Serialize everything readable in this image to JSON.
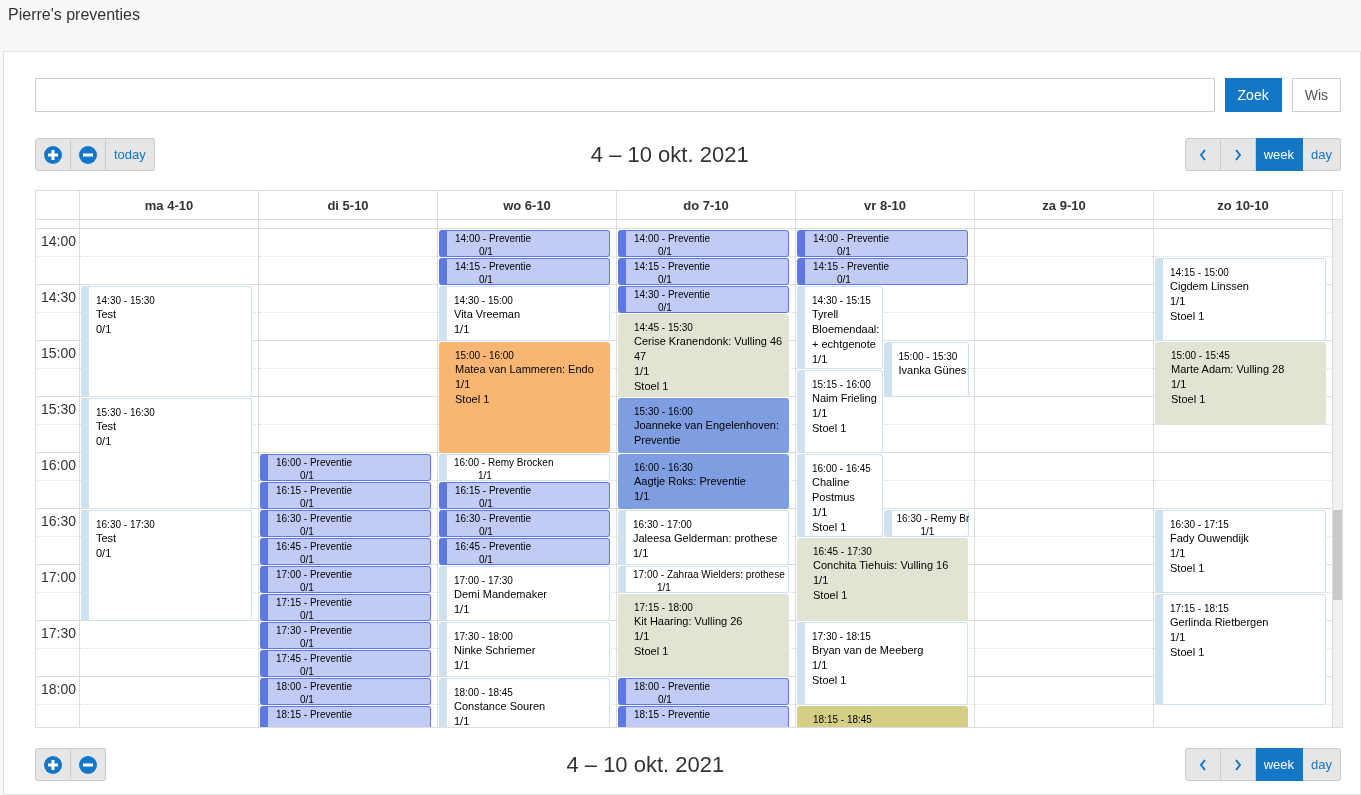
{
  "app": {
    "title": "Pierre's preventies"
  },
  "search": {
    "buttons": [
      {
        "label": "Zoek",
        "kind": "primary"
      },
      {
        "label": "Wis",
        "kind": "secondary"
      }
    ]
  },
  "top_toolbar": {
    "today": "today",
    "title": "4 – 10 okt. 2021",
    "views": [
      {
        "label": "week",
        "selected": true
      },
      {
        "label": "day",
        "selected": false
      }
    ]
  },
  "calendar": {
    "times": [
      "14:00",
      "14:30",
      "15:00",
      "15:30",
      "16:00",
      "16:30",
      "17:00",
      "17:30",
      "18:00"
    ],
    "days": [
      {
        "label": "ma 4-10",
        "events": [
          {
            "kind": "booking",
            "time": "14:30 - 15:30",
            "lines": [
              "Test",
              "0/1"
            ]
          },
          {
            "kind": "booking",
            "time": "15:30 - 16:30",
            "lines": [
              "Test",
              "0/1"
            ]
          },
          {
            "kind": "booking",
            "time": "16:30 - 17:30",
            "lines": [
              "Test",
              "0/1"
            ]
          }
        ]
      },
      {
        "label": "di 5-10",
        "events": [
          {
            "kind": "slot",
            "heading": "16:00 - Preventie",
            "count": "0/1"
          },
          {
            "kind": "slot",
            "heading": "16:15 - Preventie",
            "count": "0/1"
          },
          {
            "kind": "slot",
            "heading": "16:30 - Preventie",
            "count": "0/1"
          },
          {
            "kind": "slot",
            "heading": "16:45 - Preventie",
            "count": "0/1"
          },
          {
            "kind": "slot",
            "heading": "17:00 - Preventie",
            "count": "0/1"
          },
          {
            "kind": "slot",
            "heading": "17:15 - Preventie",
            "count": "0/1"
          },
          {
            "kind": "slot",
            "heading": "17:30 - Preventie",
            "count": "0/1"
          },
          {
            "kind": "slot",
            "heading": "17:45 - Preventie",
            "count": "0/1"
          },
          {
            "kind": "slot",
            "heading": "18:00 - Preventie",
            "count": "0/1"
          },
          {
            "kind": "slot",
            "heading": "18:15 - Preventie"
          }
        ]
      },
      {
        "label": "wo 6-10",
        "events": [
          {
            "kind": "slot",
            "heading": "14:00 - Preventie",
            "count": "0/1"
          },
          {
            "kind": "slot",
            "heading": "14:15 - Preventie",
            "count": "0/1"
          },
          {
            "kind": "booking",
            "time": "14:30 - 15:00",
            "lines": [
              "Vita Vreeman",
              "1/1"
            ]
          },
          {
            "kind": "treatment",
            "color": "#f9b672",
            "time": "15:00 - 16:00",
            "lines": [
              "Matea van Lammeren: Endo",
              "1/1",
              "Stoel 1"
            ]
          },
          {
            "kind": "short",
            "heading": "16:00 - Remy Brocken",
            "count": "1/1"
          },
          {
            "kind": "slot",
            "heading": "16:15 - Preventie",
            "count": "0/1"
          },
          {
            "kind": "slot",
            "heading": "16:30 - Preventie",
            "count": "0/1"
          },
          {
            "kind": "slot",
            "heading": "16:45 - Preventie",
            "count": "0/1"
          },
          {
            "kind": "booking",
            "time": "17:00 - 17:30",
            "lines": [
              "Demi Mandemaker",
              "1/1"
            ]
          },
          {
            "kind": "booking",
            "time": "17:30 - 18:00",
            "lines": [
              "Ninke Schriemer",
              "1/1"
            ]
          },
          {
            "kind": "booking",
            "time": "18:00 - 18:45",
            "lines": [
              "Constance Souren",
              "1/1"
            ]
          }
        ]
      },
      {
        "label": "do 7-10",
        "events": [
          {
            "kind": "slot",
            "heading": "14:00 - Preventie",
            "count": "0/1"
          },
          {
            "kind": "slot",
            "heading": "14:15 - Preventie",
            "count": "0/1"
          },
          {
            "kind": "slot",
            "heading": "14:30 - Preventie",
            "count": "0/1"
          },
          {
            "kind": "treatment",
            "color": "#e2e4d3",
            "time": "14:45 - 15:30",
            "lines": [
              "Cerise Kranendonk: Vulling 46 47",
              "1/1",
              "Stoel 1"
            ]
          },
          {
            "kind": "treatment",
            "color": "#7f9de1",
            "time": "15:30 - 16:00",
            "lines": [
              "Joanneke van Engelenhoven: Preventie"
            ]
          },
          {
            "kind": "treatment",
            "color": "#7f9de1",
            "time": "16:00 - 16:30",
            "lines": [
              "Aagtje Roks: Preventie",
              "1/1"
            ]
          },
          {
            "kind": "booking",
            "time": "16:30 - 17:00",
            "lines": [
              "Jaleesa Gelderman: prothese",
              "1/1"
            ]
          },
          {
            "kind": "short",
            "heading": "17:00 - Zahraa Wielders: prothese",
            "count": "1/1"
          },
          {
            "kind": "treatment",
            "color": "#e2e4d3",
            "time": "17:15 - 18:00",
            "lines": [
              "Kit Haaring: Vulling 26",
              "1/1",
              "Stoel 1"
            ]
          },
          {
            "kind": "slot",
            "heading": "18:00 - Preventie",
            "count": "0/1"
          },
          {
            "kind": "slot",
            "heading": "18:15 - Preventie"
          }
        ]
      },
      {
        "label": "vr 8-10",
        "events": [
          {
            "kind": "slot",
            "heading": "14:00 - Preventie",
            "count": "0/1"
          },
          {
            "kind": "slot",
            "heading": "14:15 - Preventie",
            "count": "0/1"
          },
          {
            "kind": "booking",
            "time": "14:30 - 15:15",
            "lines": [
              "Tyrell Bloemendaal: + echtgenote",
              "1/1"
            ]
          },
          {
            "kind": "booking",
            "time": "15:00 - 15:30",
            "lines": [
              "Ivanka Günes"
            ]
          },
          {
            "kind": "booking",
            "time": "15:15 - 16:00",
            "lines": [
              "Naim Frieling",
              "1/1",
              "Stoel 1"
            ]
          },
          {
            "kind": "booking",
            "time": "16:00 - 16:45",
            "lines": [
              "Chaline Postmus",
              "1/1",
              "Stoel 1"
            ]
          },
          {
            "kind": "short",
            "heading": "16:30 - Remy Br",
            "count": "1/1"
          },
          {
            "kind": "treatment",
            "color": "#e2e4d3",
            "time": "16:45 - 17:30",
            "lines": [
              "Conchita Tiehuis: Vulling 16",
              "1/1",
              "Stoel 1"
            ]
          },
          {
            "kind": "booking",
            "time": "17:30 - 18:15",
            "lines": [
              "Bryan van de Meeberg",
              "1/1",
              "Stoel 1"
            ]
          },
          {
            "kind": "treatment",
            "color": "#d5cf85",
            "time": "18:15 - 18:45"
          }
        ]
      },
      {
        "label": "za 9-10"
      },
      {
        "label": "zo 10-10",
        "events": [
          {
            "kind": "booking",
            "time": "14:15 - 15:00",
            "lines": [
              "Cigdem Linssen",
              "1/1",
              "Stoel 1"
            ]
          },
          {
            "kind": "treatment",
            "color": "#e2e4d3",
            "time": "15:00 - 15:45",
            "lines": [
              "Marte Adam: Vulling 28",
              "1/1",
              "Stoel 1"
            ]
          },
          {
            "kind": "booking",
            "time": "16:30 - 17:15",
            "lines": [
              "Fady Ouwendijk",
              "1/1",
              "Stoel 1"
            ]
          },
          {
            "kind": "booking",
            "time": "17:15 - 18:15",
            "lines": [
              "Gerlinda Rietbergen",
              "1/1",
              "Stoel 1"
            ]
          }
        ]
      }
    ]
  },
  "bottom_toolbar": {
    "title": "4 – 10 okt. 2021",
    "views": [
      {
        "label": "week",
        "selected": true
      },
      {
        "label": "day",
        "selected": false
      }
    ]
  }
}
